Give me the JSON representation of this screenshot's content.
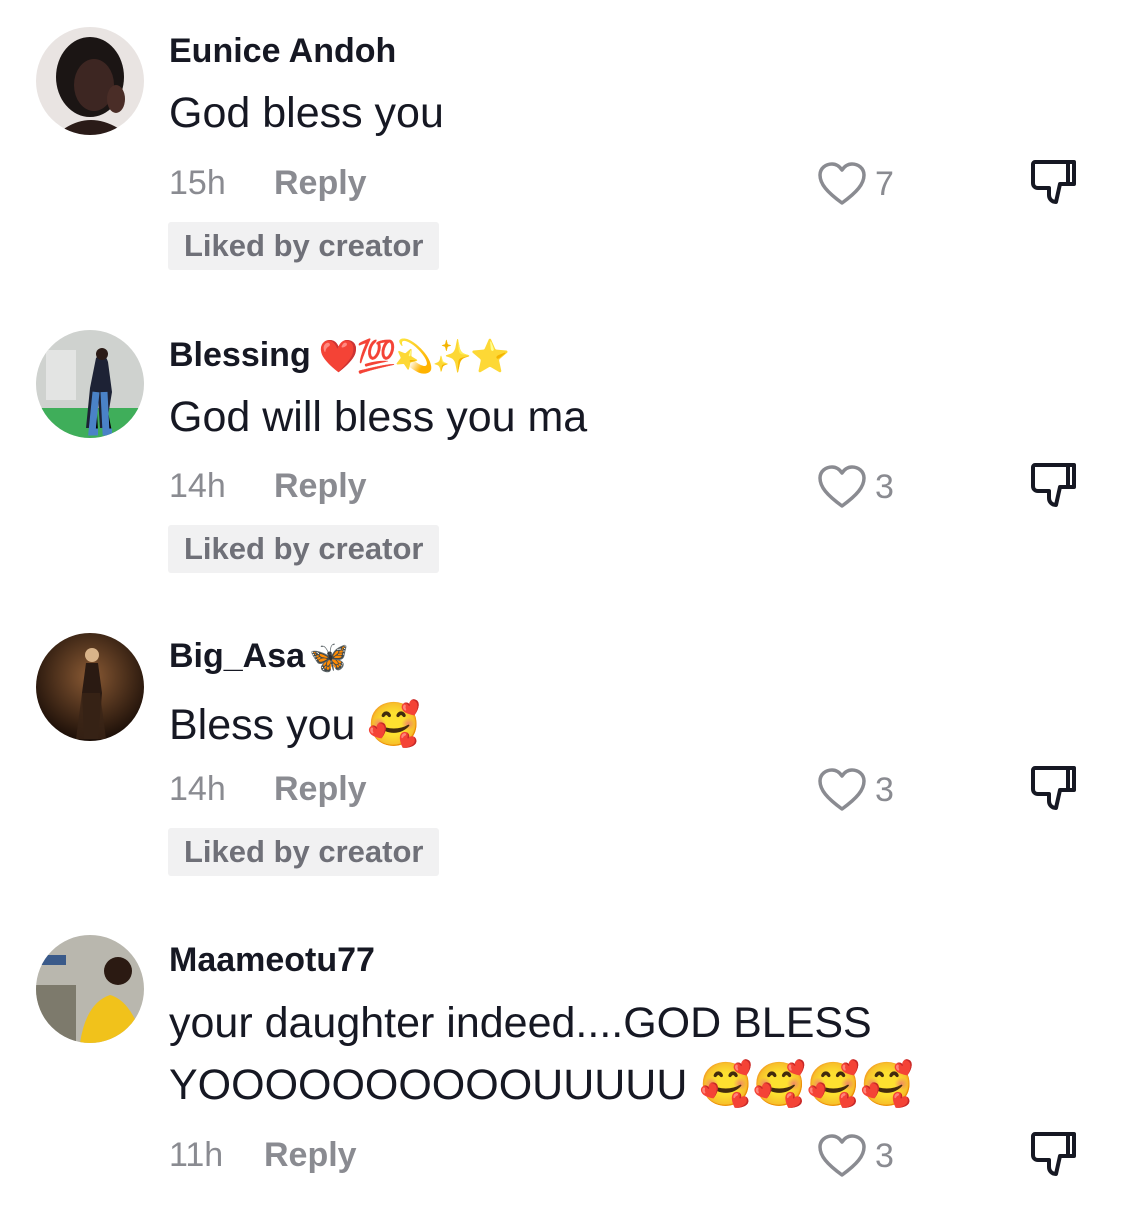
{
  "comments": [
    {
      "username": "Eunice Andoh",
      "username_emoji": "",
      "text_lines": [
        "God bless you"
      ],
      "time": "15h",
      "reply_label": "Reply",
      "likes": "7",
      "badge": "Liked by creator"
    },
    {
      "username": "Blessing",
      "username_emoji": "❤️💯💫✨⭐",
      "text_lines": [
        "God will bless you ma"
      ],
      "time": "14h",
      "reply_label": "Reply",
      "likes": "3",
      "badge": "Liked by creator"
    },
    {
      "username": "Big_Asa",
      "username_emoji": "🦋",
      "text_lines": [
        "Bless you 🥰"
      ],
      "time": "14h",
      "reply_label": "Reply",
      "likes": "3",
      "badge": "Liked by creator"
    },
    {
      "username": "Maameotu77",
      "username_emoji": "",
      "text_lines": [
        "your daughter indeed....GOD BLESS",
        "YOOOOOOOOOOUUUUU 🥰🥰🥰🥰"
      ],
      "time": "11h",
      "reply_label": "Reply",
      "likes": "3",
      "badge": ""
    }
  ],
  "icons": {
    "like": "heart-outline-icon",
    "dislike": "thumbs-down-outline-icon"
  },
  "colors": {
    "primary_text": "#161823",
    "secondary_text": "#8a8b91",
    "badge_bg": "#f1f1f2"
  }
}
